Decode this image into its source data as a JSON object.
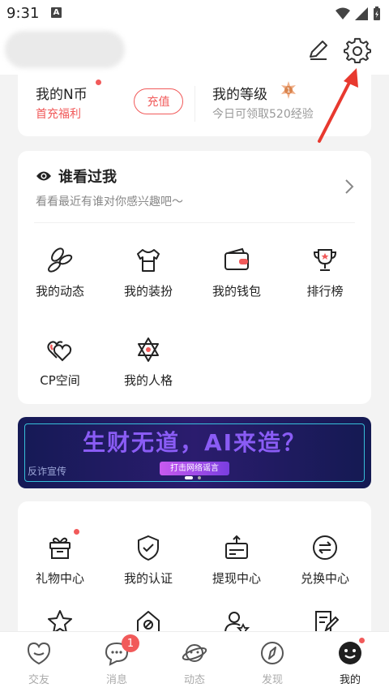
{
  "status_bar": {
    "time": "9:31",
    "notif_letter": "A"
  },
  "wallet": {
    "ncoin_label": "我的N币",
    "welfare_label": "首充福利",
    "recharge_label": "充值",
    "level_label": "我的等级",
    "level_badge": "1",
    "level_sub": "今日可领取520经验"
  },
  "viewed": {
    "title": "谁看过我",
    "subtitle": "看看最近有谁对你感兴趣吧～"
  },
  "grid": [
    {
      "label": "我的动态",
      "icon": "leaf-icon"
    },
    {
      "label": "我的装扮",
      "icon": "tshirt-icon"
    },
    {
      "label": "我的钱包",
      "icon": "wallet-icon"
    },
    {
      "label": "排行榜",
      "icon": "trophy-icon"
    },
    {
      "label": "CP空间",
      "icon": "hearts-icon"
    },
    {
      "label": "我的人格",
      "icon": "star-of-david-icon"
    }
  ],
  "banner": {
    "headline": "生财无道，AI来造？",
    "tagline": "打击网络谣言",
    "fraud": "反诈宣传"
  },
  "services": [
    {
      "label": "礼物中心",
      "icon": "gift-icon"
    },
    {
      "label": "我的认证",
      "icon": "shield-check-icon"
    },
    {
      "label": "提现中心",
      "icon": "withdraw-icon"
    },
    {
      "label": "兑换中心",
      "icon": "exchange-icon"
    }
  ],
  "tabbar": [
    {
      "label": "交友",
      "icon": "heart-chat-icon",
      "active": false
    },
    {
      "label": "消息",
      "icon": "message-icon",
      "active": false,
      "badge": "1"
    },
    {
      "label": "动态",
      "icon": "planet-icon",
      "active": false
    },
    {
      "label": "发现",
      "icon": "compass-icon",
      "active": false
    },
    {
      "label": "我的",
      "icon": "smile-face-icon",
      "active": true
    }
  ],
  "colors": {
    "accent": "#f15a5a",
    "background": "#f3f3f3",
    "banner_bg": "#151a55"
  }
}
